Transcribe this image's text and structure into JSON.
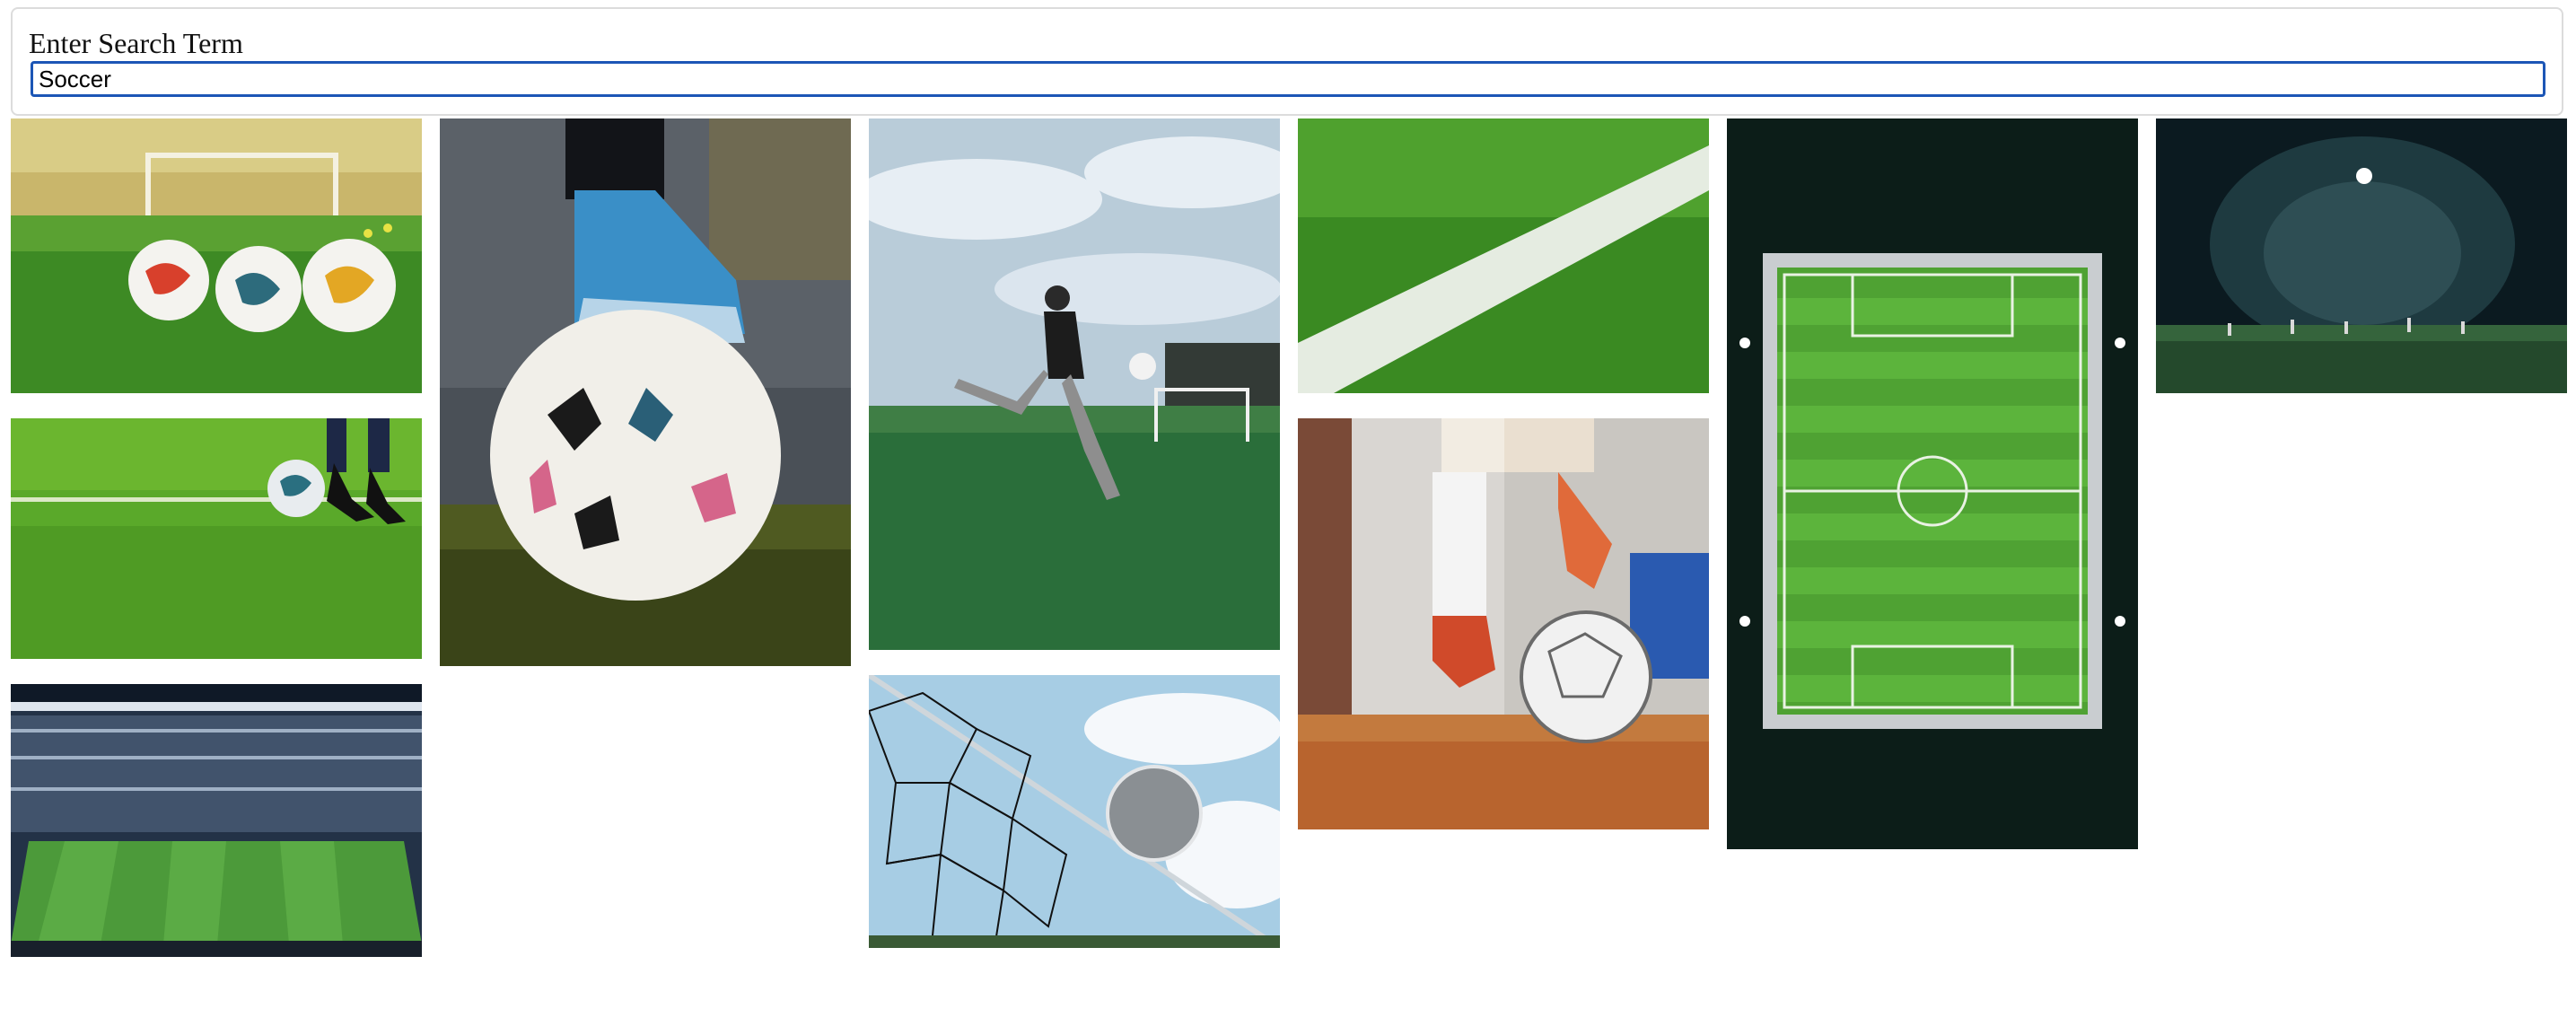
{
  "search": {
    "label": "Enter Search Term",
    "value": "Soccer"
  },
  "gallery": {
    "images": [
      {
        "subject": "three soccer balls on grass in front of goal"
      },
      {
        "subject": "foot on soccer ball close-up"
      },
      {
        "subject": "player kicking ball under cloudy sky"
      },
      {
        "subject": "white line on green turf"
      },
      {
        "subject": "aerial view of soccer pitch at night"
      },
      {
        "subject": "floodlit field at night"
      },
      {
        "subject": "player dribbling ball on grass"
      },
      {
        "subject": "player striking ball on clay court"
      },
      {
        "subject": "stadium interior with pitch"
      },
      {
        "subject": "ball in goal net"
      }
    ]
  },
  "colors": {
    "focus_ring": "#1c56b6",
    "grass": "#3f8f25",
    "sky": "#9bbfd8",
    "night": "#0b1a1e"
  }
}
